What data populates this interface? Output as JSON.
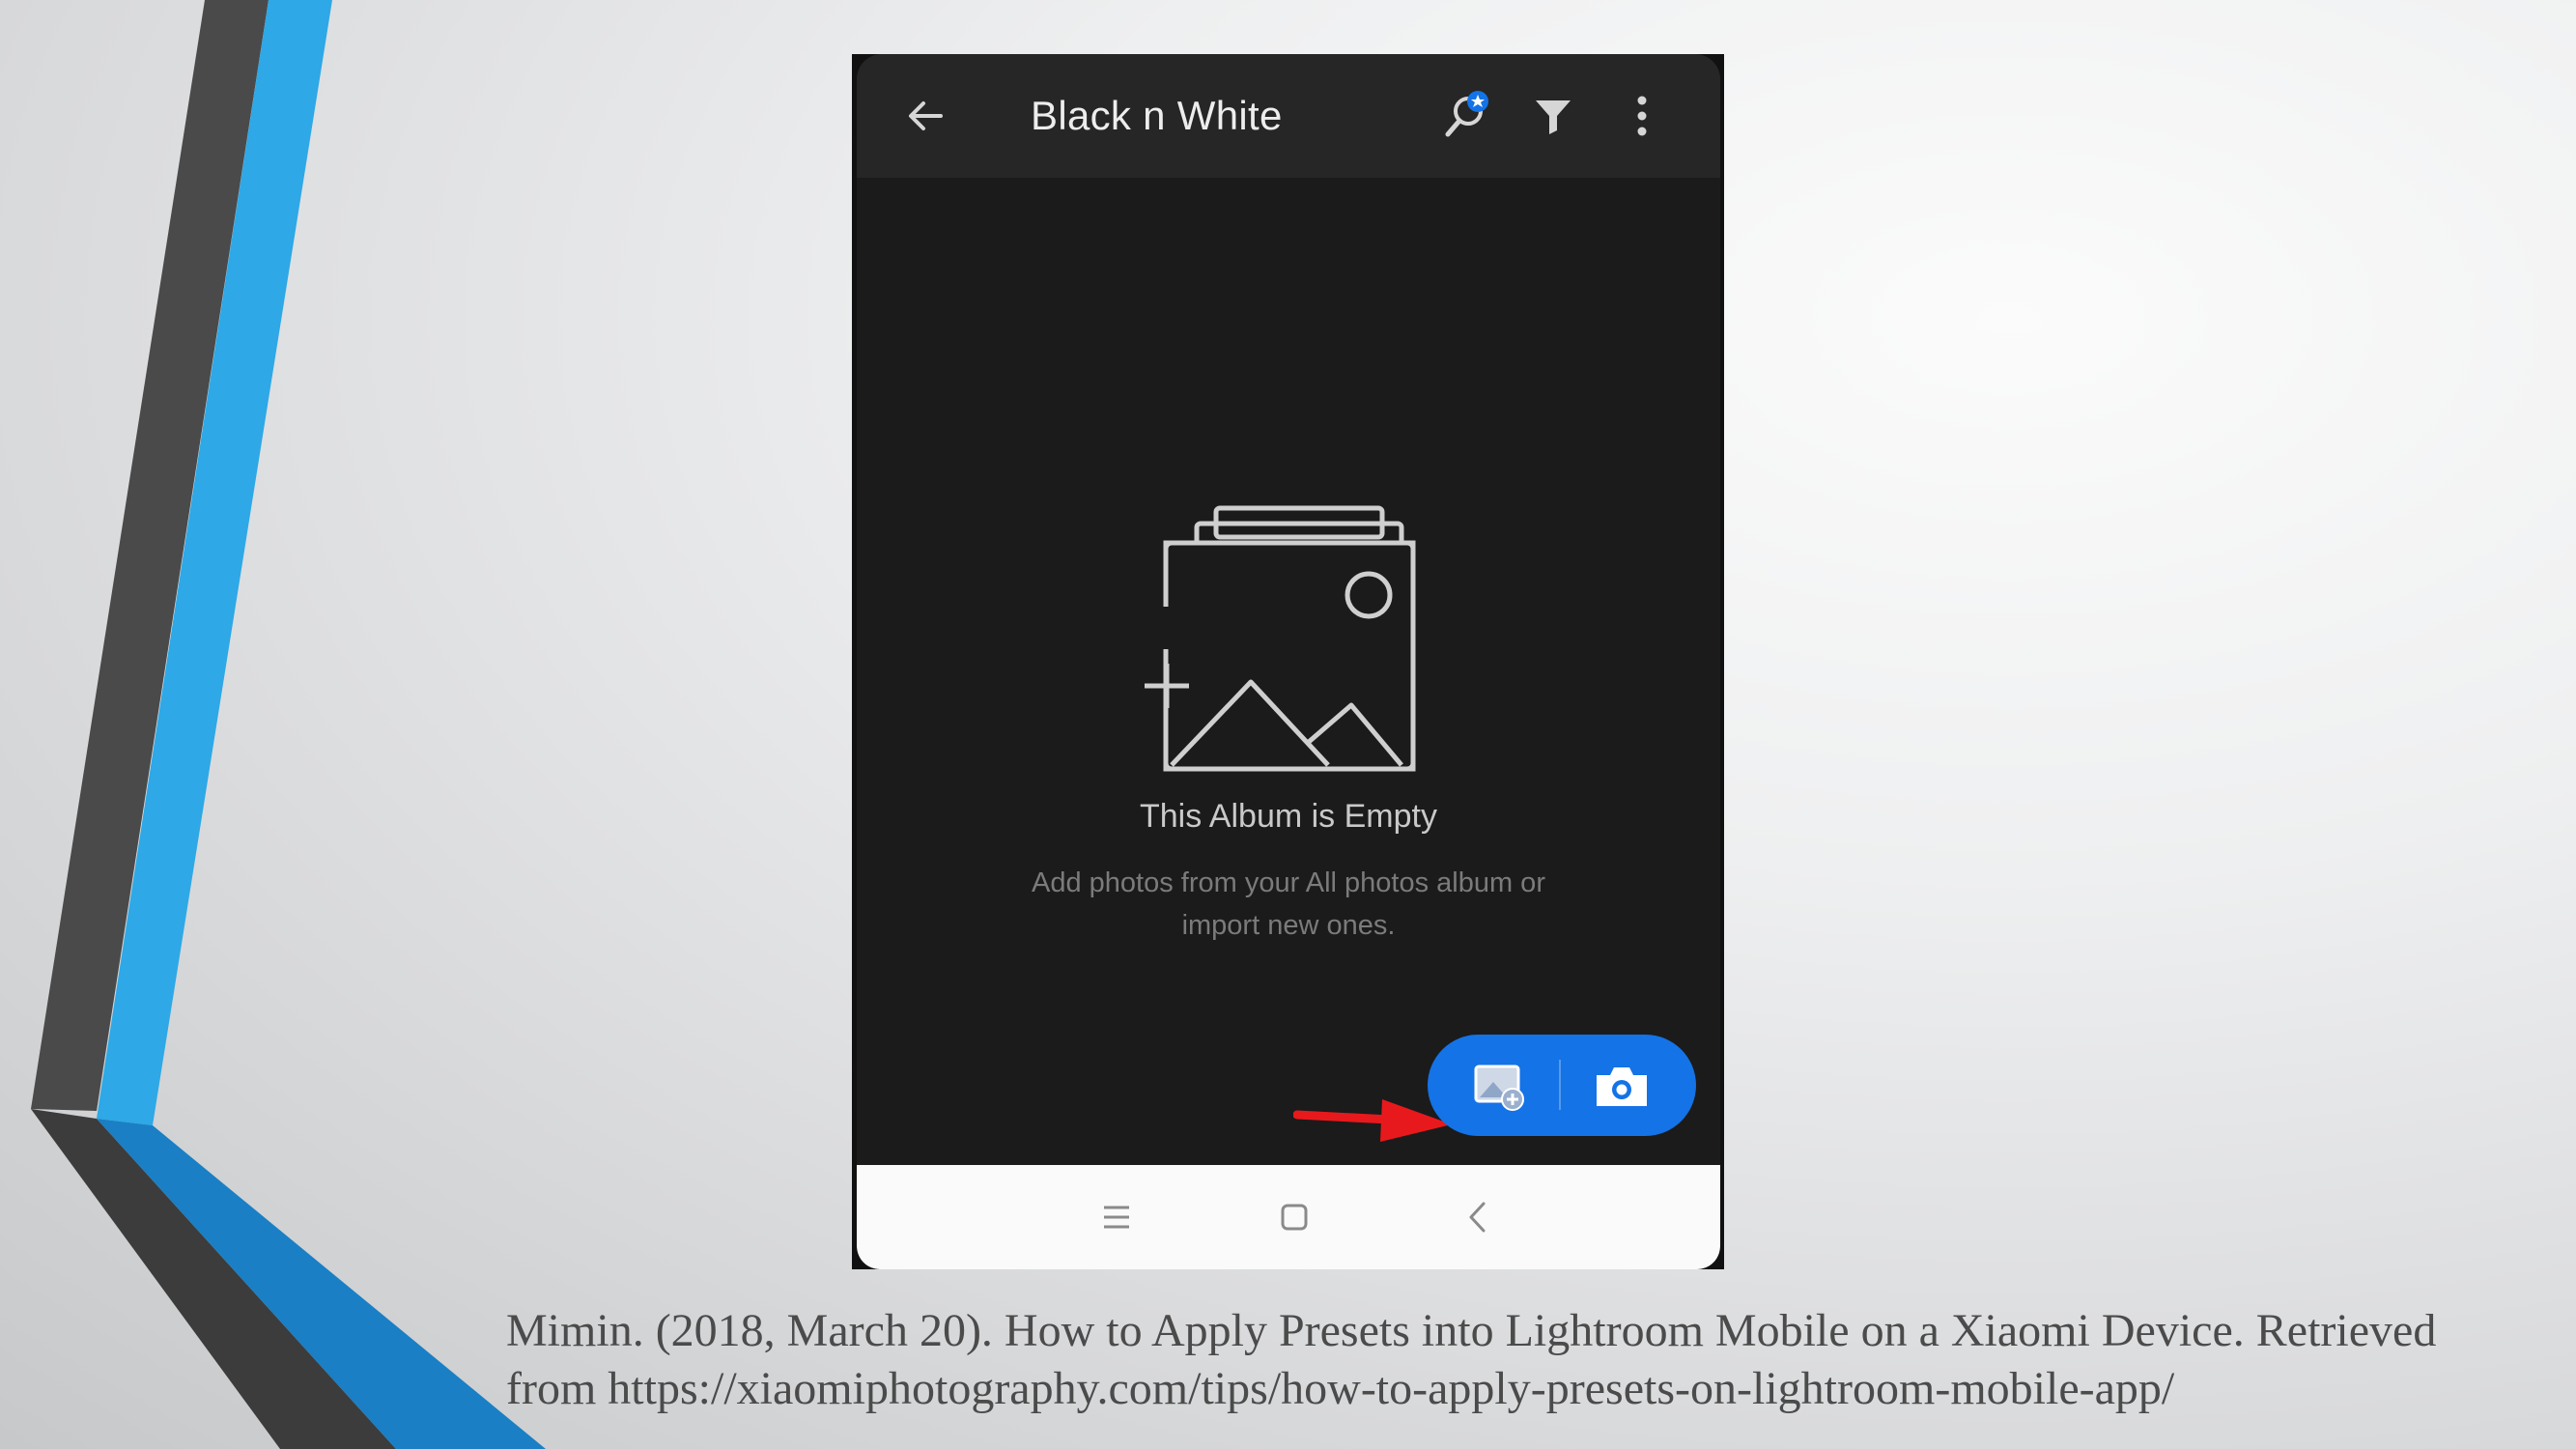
{
  "slide": {
    "accent_colors": {
      "blue": "#2ea8e6",
      "dark_blue": "#1a7fc4",
      "dark_gray": "#454545"
    },
    "citation": {
      "line1": "Mimin. (2018, March 20). How to Apply Presets into Lightroom Mobile on a Xiaomi Device. Retrieved",
      "line2": "from https://xiaomiphotography.com/tips/how-to-apply-presets-on-lightroom-mobile-app/"
    }
  },
  "phone": {
    "app_bar": {
      "title": "Black n White",
      "icons": [
        "arrow-left-icon",
        "search-people-icon",
        "filter-icon",
        "more-vert-icon"
      ]
    },
    "empty_state": {
      "icon": "add-photos-illustration-icon",
      "title": "This Album is Empty",
      "subtitle_line1": "Add photos from your All photos album or",
      "subtitle_line2": "import new ones."
    },
    "fab": {
      "color": "#1473e6",
      "buttons": [
        "add-photos-icon",
        "camera-icon"
      ]
    },
    "annotation_arrow_color": "#e8191c",
    "system_nav": {
      "icons": [
        "menu-lines-icon",
        "home-square-icon",
        "back-chevron-icon"
      ]
    }
  }
}
